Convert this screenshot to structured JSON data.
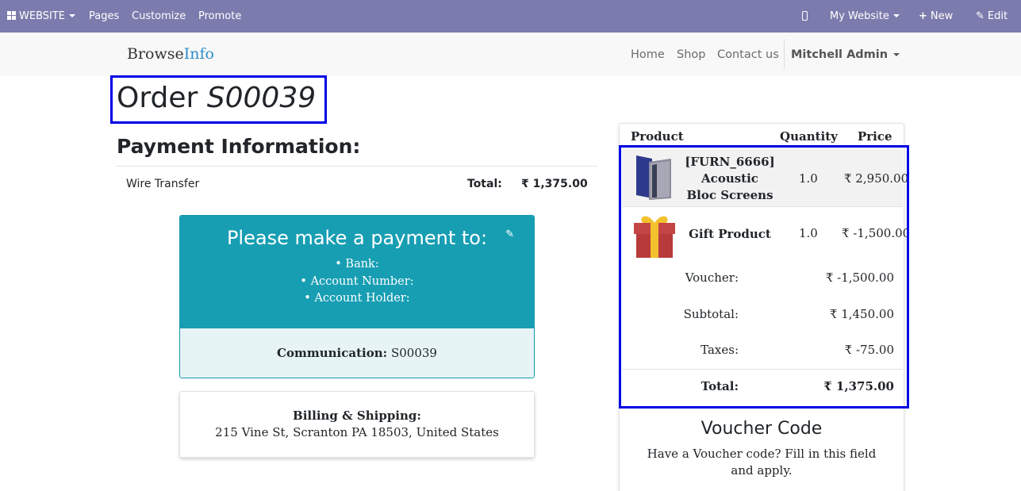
{
  "adminbar": {
    "website_label": "WEBSITE",
    "pages": "Pages",
    "customize": "Customize",
    "promote": "Promote",
    "my_website": "My Website",
    "new": "New",
    "edit": "Edit",
    "bg_color": "#7c7bad"
  },
  "header": {
    "logo_browse": "Browse",
    "logo_info": "Info",
    "nav": {
      "home": "Home",
      "shop": "Shop",
      "contact": "Contact us"
    },
    "user": "Mitchell Admin"
  },
  "order": {
    "prefix": "Order",
    "number": "S00039"
  },
  "payment": {
    "heading": "Payment Information:",
    "method": "Wire Transfer",
    "total_label": "Total:",
    "total_value": "₹ 1,375.00"
  },
  "instructions": {
    "title": "Please make a payment to:",
    "bank": "• Bank:",
    "account_number": "• Account Number:",
    "account_holder": "• Account Holder:",
    "communication_label": "Communication:",
    "communication_value": "S00039",
    "color": "#179eb3"
  },
  "billing": {
    "label": "Billing & Shipping:",
    "address": "215 Vine St, Scranton PA 18503, United States"
  },
  "summary": {
    "headers": {
      "product": "Product",
      "quantity": "Quantity",
      "price": "Price"
    },
    "lines": [
      {
        "name_l1": "[FURN_6666]",
        "name_l2": "Acoustic",
        "name_l3": "Bloc Screens",
        "qty": "1.0",
        "price": "₹ 2,950.00",
        "icon": "acoustic-screen-image"
      },
      {
        "name": "Gift Product",
        "qty": "1.0",
        "price": "₹ -1,500.00",
        "icon": "gift-box-image"
      }
    ],
    "voucher_label": "Voucher:",
    "voucher_value": "₹ -1,500.00",
    "subtotal_label": "Subtotal:",
    "subtotal_value": "₹ 1,450.00",
    "taxes_label": "Taxes:",
    "taxes_value": "₹ -75.00",
    "total_label": "Total:",
    "total_value": "₹ 1,375.00"
  },
  "voucher": {
    "heading": "Voucher Code",
    "text": "Have a Voucher code? Fill in this field and apply."
  }
}
